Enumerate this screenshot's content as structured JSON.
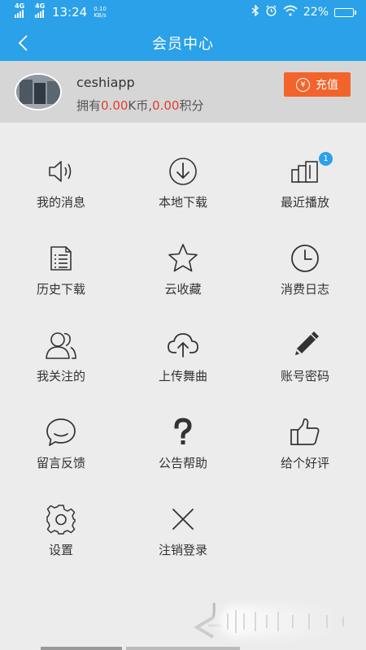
{
  "status_bar": {
    "sim1": "4G",
    "sim2": "4G",
    "time": "13:24",
    "net_speed_value": "0.10",
    "net_speed_unit": "KB/s",
    "battery": "22%",
    "battery_level": 0.22
  },
  "header": {
    "title": "会员中心"
  },
  "profile": {
    "username": "ceshiapp",
    "balance_prefix": "拥有",
    "k_coins": "0.00",
    "k_unit": "K币,",
    "points": "0.00",
    "points_unit": "积分",
    "recharge_label": "充值",
    "recharge_icon_text": "¥"
  },
  "menu": {
    "items": [
      {
        "label": "我的消息",
        "icon": "speaker-icon"
      },
      {
        "label": "本地下载",
        "icon": "download-icon"
      },
      {
        "label": "最近播放",
        "icon": "recent-play-icon",
        "badge": "1"
      },
      {
        "label": "历史下载",
        "icon": "document-list-icon"
      },
      {
        "label": "云收藏",
        "icon": "star-icon"
      },
      {
        "label": "消费日志",
        "icon": "clock-icon"
      },
      {
        "label": "我关注的",
        "icon": "users-icon"
      },
      {
        "label": "上传舞曲",
        "icon": "cloud-upload-icon"
      },
      {
        "label": "账号密码",
        "icon": "pencil-icon"
      },
      {
        "label": "留言反馈",
        "icon": "chat-bubble-icon"
      },
      {
        "label": "公告帮助",
        "icon": "question-icon"
      },
      {
        "label": "给个好评",
        "icon": "thumbs-up-icon"
      },
      {
        "label": "设置",
        "icon": "gear-icon"
      },
      {
        "label": "注销登录",
        "icon": "close-icon"
      }
    ]
  },
  "colors": {
    "primary": "#2aa1e9",
    "accent": "#f2642b",
    "highlight_number": "#e33b2f",
    "background": "#ececec",
    "profile_background": "#d6d6d6"
  }
}
